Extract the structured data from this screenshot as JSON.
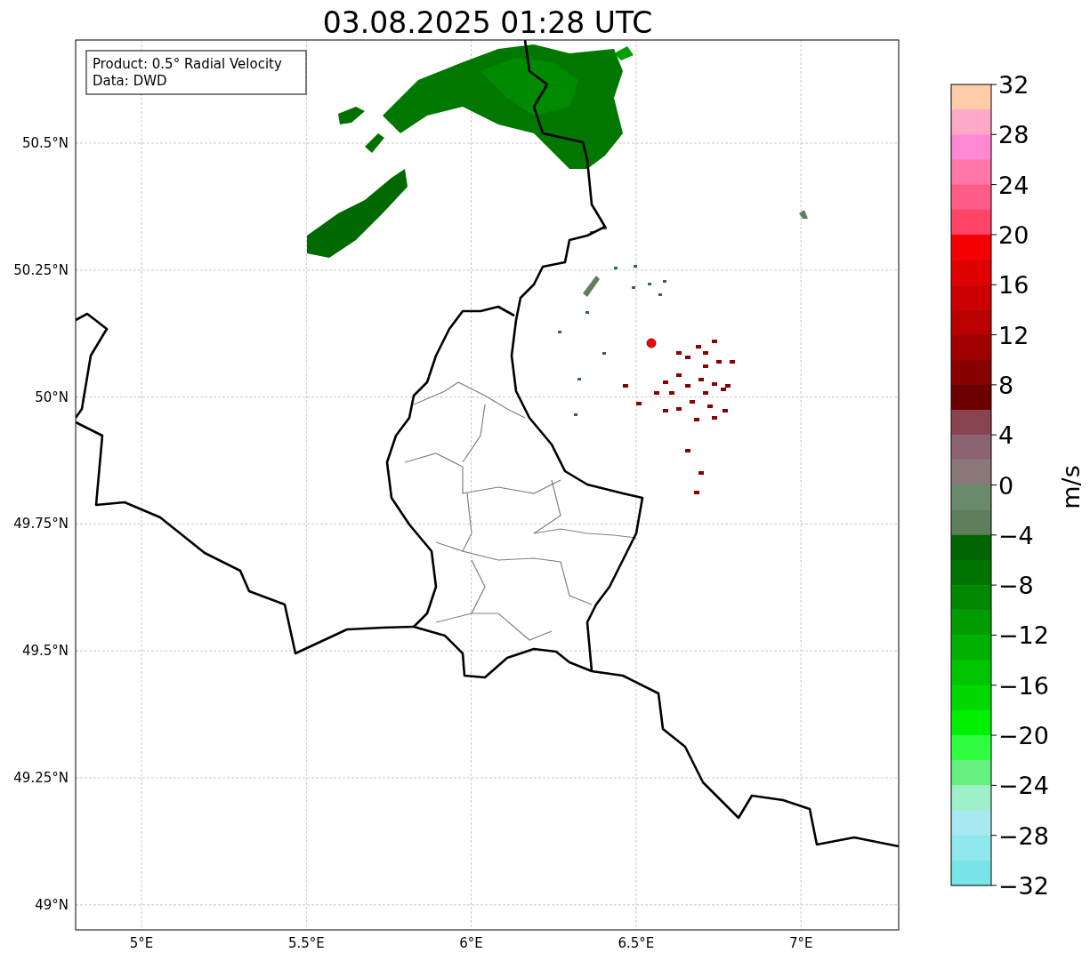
{
  "title": "03.08.2025 01:28 UTC",
  "legend": {
    "lines": [
      "Product: 0.5° Radial Velocity",
      "Data: DWD"
    ]
  },
  "map": {
    "y_ticks": [
      "50.5°N",
      "50.25°N",
      "50°N",
      "49.75°N",
      "49.5°N",
      "49.25°N",
      "49°N"
    ],
    "x_ticks": [
      "5°E",
      "5.5°E",
      "6°E",
      "6.5°E",
      "7°E"
    ]
  },
  "colorbar": {
    "label": "m/s",
    "ticks": [
      "32",
      "28",
      "24",
      "20",
      "16",
      "12",
      "8",
      "4",
      "0",
      "−4",
      "−8",
      "−12",
      "−16",
      "−20",
      "−24",
      "−28",
      "−32"
    ],
    "segments": [
      {
        "color": "#ffccaa"
      },
      {
        "color": "#ffa8c8"
      },
      {
        "color": "#ff88d2"
      },
      {
        "color": "#ff78a8"
      },
      {
        "color": "#ff5c88"
      },
      {
        "color": "#ff4466"
      },
      {
        "color": "#f40000"
      },
      {
        "color": "#e00000"
      },
      {
        "color": "#cc0000"
      },
      {
        "color": "#b80000"
      },
      {
        "color": "#a00000"
      },
      {
        "color": "#880000"
      },
      {
        "color": "#6c0000"
      },
      {
        "color": "#884450"
      },
      {
        "color": "#8a6470"
      },
      {
        "color": "#8a7878"
      },
      {
        "color": "#6a8a6c"
      },
      {
        "color": "#5e7e5c"
      },
      {
        "color": "#006400"
      },
      {
        "color": "#007400"
      },
      {
        "color": "#008800"
      },
      {
        "color": "#009c00"
      },
      {
        "color": "#00b000"
      },
      {
        "color": "#00c400"
      },
      {
        "color": "#00d800"
      },
      {
        "color": "#00f000"
      },
      {
        "color": "#30ff40"
      },
      {
        "color": "#66f080"
      },
      {
        "color": "#9ef0c8"
      },
      {
        "color": "#a8e8f0"
      },
      {
        "color": "#90e8ec"
      },
      {
        "color": "#78e4e8"
      }
    ]
  }
}
